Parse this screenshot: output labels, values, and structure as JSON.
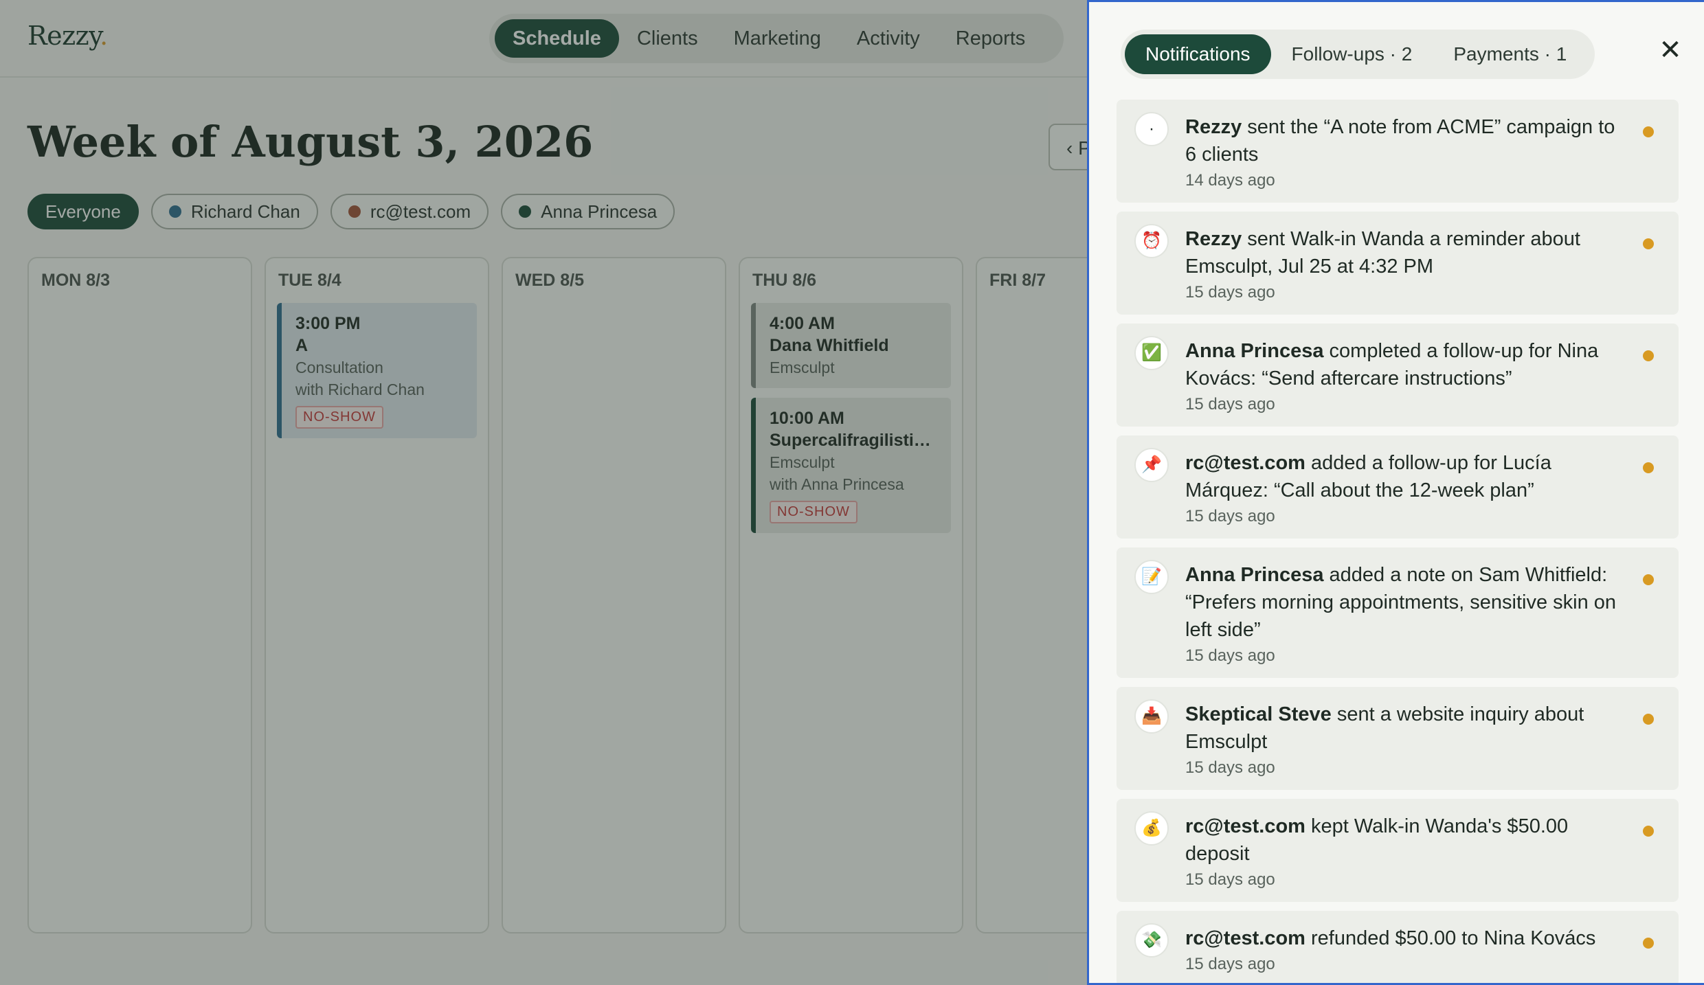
{
  "app": {
    "logo_text": "Rezzy",
    "logo_dot": ".",
    "nav": [
      {
        "label": "Schedule",
        "active": true
      },
      {
        "label": "Clients"
      },
      {
        "label": "Marketing"
      },
      {
        "label": "Activity"
      },
      {
        "label": "Reports"
      }
    ],
    "week_title": "Week of August 3, 2026",
    "prev_label": "‹ P",
    "filters": [
      {
        "label": "Everyone",
        "active": true
      },
      {
        "label": "Richard Chan",
        "color": "#2f6d8f"
      },
      {
        "label": "rc@test.com",
        "color": "#a0533a"
      },
      {
        "label": "Anna Princesa",
        "color": "#1d4a3a"
      }
    ],
    "days": [
      {
        "label": "MON 8/3",
        "appointments": []
      },
      {
        "label": "TUE 8/4",
        "appointments": [
          {
            "time": "3:00 PM",
            "name": "A",
            "service": "Consultation",
            "staff": "with Richard Chan",
            "badge": "NO-SHOW"
          }
        ]
      },
      {
        "label": "WED 8/5",
        "appointments": []
      },
      {
        "label": "THU 8/6",
        "appointments": [
          {
            "time": "4:00 AM",
            "name": "Dana Whitfield",
            "service": "Emsculpt"
          },
          {
            "time": "10:00 AM",
            "name": "Supercalifragilistice...",
            "service": "Emsculpt",
            "staff": "with Anna Princesa",
            "badge": "NO-SHOW"
          }
        ]
      },
      {
        "label": "FRI 8/7",
        "appointments": []
      }
    ]
  },
  "panel": {
    "tabs": [
      {
        "label": "Notifications",
        "active": true
      },
      {
        "label": "Follow-ups · 2"
      },
      {
        "label": "Payments · 1"
      }
    ],
    "close_glyph": "✕",
    "notifications": [
      {
        "icon": "·",
        "icon_name": "dot-icon",
        "actor": "Rezzy",
        "text": " sent the “A note from ACME” campaign to 6 clients",
        "time": "14 days ago"
      },
      {
        "icon": "⏰",
        "icon_name": "alarm-clock-icon",
        "actor": "Rezzy",
        "text": " sent Walk-in Wanda a reminder about Emsculpt, Jul 25 at 4:32 PM",
        "time": "15 days ago"
      },
      {
        "icon": "✅",
        "icon_name": "check-mark-icon",
        "actor": "Anna Princesa",
        "text": " completed a follow-up for Nina Kovács: “Send aftercare instructions”",
        "time": "15 days ago"
      },
      {
        "icon": "📌",
        "icon_name": "pushpin-icon",
        "actor": "rc@test.com",
        "text": " added a follow-up for Lucía Márquez: “Call about the 12-week plan”",
        "time": "15 days ago"
      },
      {
        "icon": "📝",
        "icon_name": "memo-icon",
        "actor": "Anna Princesa",
        "text": " added a note on Sam Whitfield: “Prefers morning appointments, sensitive skin on left side”",
        "time": "15 days ago"
      },
      {
        "icon": "📥",
        "icon_name": "inbox-tray-icon",
        "actor": "Skeptical Steve",
        "text": " sent a website inquiry about Emsculpt",
        "time": "15 days ago"
      },
      {
        "icon": "💰",
        "icon_name": "money-bag-icon",
        "actor": "rc@test.com",
        "text": " kept Walk-in Wanda's $50.00 deposit",
        "time": "15 days ago"
      },
      {
        "icon": "💸",
        "icon_name": "money-with-wings-icon",
        "actor": "rc@test.com",
        "text": " refunded $50.00 to Nina Kovács",
        "time": "15 days ago"
      }
    ]
  },
  "colors": {
    "brand_green": "#1d4a3a",
    "accent_gold": "#d89a22",
    "no_show_red": "#c43a3a",
    "panel_border": "#3366cc"
  }
}
